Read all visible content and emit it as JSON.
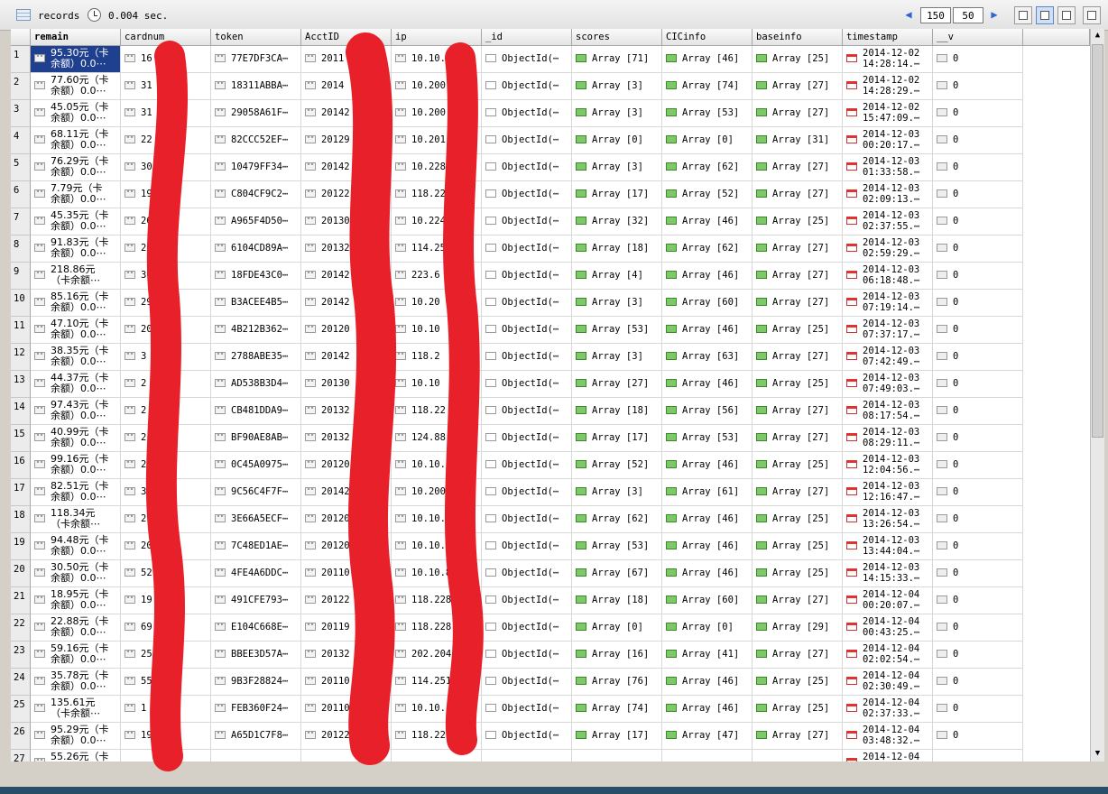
{
  "toolbar": {
    "records_label": "records",
    "time_label": "0.004 sec.",
    "start_value": "150",
    "limit_value": "50",
    "icons": {
      "records": "table-grid-icon",
      "time": "clock-icon",
      "prev": "arrow-left-icon",
      "next": "arrow-right-icon"
    }
  },
  "columns": [
    "remain",
    "cardnum",
    "token",
    "AcctID",
    "ip",
    "_id",
    "scores",
    "CICinfo",
    "baseinfo",
    "timestamp",
    "__v"
  ],
  "rows": [
    {
      "n": "1",
      "remain": "95.30元（卡\n余额）0.0⋯",
      "cardnum": "16",
      "token": "77E7DF3CA⋯",
      "acct": "2011",
      "ip": "10.10.",
      "oid": "ObjectId(⋯",
      "scores": "Array [71]",
      "cic": "Array [46]",
      "base": "Array [25]",
      "ts": "2014-12-02\n14:28:14.⋯",
      "v": "0"
    },
    {
      "n": "2",
      "remain": "77.60元（卡\n余额）0.0⋯",
      "cardnum": "31",
      "token": "18311ABBA⋯",
      "acct": "2014",
      "ip": "10.200",
      "oid": "ObjectId(⋯",
      "scores": "Array [3]",
      "cic": "Array [74]",
      "base": "Array [27]",
      "ts": "2014-12-02\n14:28:29.⋯",
      "v": "0"
    },
    {
      "n": "3",
      "remain": "45.05元（卡\n余额）0.0⋯",
      "cardnum": "31",
      "token": "29058A61F⋯",
      "acct": "20142",
      "ip": "10.200",
      "oid": "ObjectId(⋯",
      "scores": "Array [3]",
      "cic": "Array [53]",
      "base": "Array [27]",
      "ts": "2014-12-02\n15:47:09.⋯",
      "v": "0"
    },
    {
      "n": "4",
      "remain": "68.11元（卡\n余额）0.0⋯",
      "cardnum": "22",
      "token": "82CCC52EF⋯",
      "acct": "20129",
      "ip": "10.201",
      "oid": "ObjectId(⋯",
      "scores": "Array [0]",
      "cic": "Array [0]",
      "base": "Array [31]",
      "ts": "2014-12-03\n00:20:17.⋯",
      "v": "0"
    },
    {
      "n": "5",
      "remain": "76.29元（卡\n余额）0.0⋯",
      "cardnum": "30",
      "token": "10479FF34⋯",
      "acct": "20142",
      "ip": "10.228",
      "oid": "ObjectId(⋯",
      "scores": "Array [3]",
      "cic": "Array [62]",
      "base": "Array [27]",
      "ts": "2014-12-03\n01:33:58.⋯",
      "v": "0"
    },
    {
      "n": "6",
      "remain": "7.79元（卡\n余额）0.0⋯",
      "cardnum": "19",
      "token": "C804CF9C2⋯",
      "acct": "20122",
      "ip": "118.22",
      "oid": "ObjectId(⋯",
      "scores": "Array [17]",
      "cic": "Array [52]",
      "base": "Array [27]",
      "ts": "2014-12-03\n02:09:13.⋯",
      "v": "0"
    },
    {
      "n": "7",
      "remain": "45.35元（卡\n余额）0.0⋯",
      "cardnum": "26",
      "token": "A965F4D50⋯",
      "acct": "20130",
      "ip": "10.224",
      "oid": "ObjectId(⋯",
      "scores": "Array [32]",
      "cic": "Array [46]",
      "base": "Array [25]",
      "ts": "2014-12-03\n02:37:55.⋯",
      "v": "0"
    },
    {
      "n": "8",
      "remain": "91.83元（卡\n余额）0.0⋯",
      "cardnum": "25",
      "token": "6104CD89A⋯",
      "acct": "20132",
      "ip": "114.25",
      "oid": "ObjectId(⋯",
      "scores": "Array [18]",
      "cic": "Array [62]",
      "base": "Array [27]",
      "ts": "2014-12-03\n02:59:29.⋯",
      "v": "0"
    },
    {
      "n": "9",
      "remain": "218.86元\n（卡余额⋯",
      "cardnum": "30",
      "token": "18FDE43C0⋯",
      "acct": "20142",
      "ip": "223.6",
      "oid": "ObjectId(⋯",
      "scores": "Array [4]",
      "cic": "Array [46]",
      "base": "Array [27]",
      "ts": "2014-12-03\n06:18:48.⋯",
      "v": "0"
    },
    {
      "n": "10",
      "remain": "85.16元（卡\n余额）0.0⋯",
      "cardnum": "29",
      "token": "B3ACEE4B5⋯",
      "acct": "20142",
      "ip": "10.20",
      "oid": "ObjectId(⋯",
      "scores": "Array [3]",
      "cic": "Array [60]",
      "base": "Array [27]",
      "ts": "2014-12-03\n07:19:14.⋯",
      "v": "0"
    },
    {
      "n": "11",
      "remain": "47.10元（卡\n余额）0.0⋯",
      "cardnum": "20",
      "token": "4B212B362⋯",
      "acct": "20120",
      "ip": "10.10",
      "oid": "ObjectId(⋯",
      "scores": "Array [53]",
      "cic": "Array [46]",
      "base": "Array [25]",
      "ts": "2014-12-03\n07:37:17.⋯",
      "v": "0"
    },
    {
      "n": "12",
      "remain": "38.35元（卡\n余额）0.0⋯",
      "cardnum": "3",
      "token": "2788ABE35⋯",
      "acct": "20142",
      "ip": "118.2",
      "oid": "ObjectId(⋯",
      "scores": "Array [3]",
      "cic": "Array [63]",
      "base": "Array [27]",
      "ts": "2014-12-03\n07:42:49.⋯",
      "v": "0"
    },
    {
      "n": "13",
      "remain": "44.37元（卡\n余额）0.0⋯",
      "cardnum": "2",
      "token": "AD538B3D4⋯",
      "acct": "20130",
      "ip": "10.10",
      "oid": "ObjectId(⋯",
      "scores": "Array [27]",
      "cic": "Array [46]",
      "base": "Array [25]",
      "ts": "2014-12-03\n07:49:03.⋯",
      "v": "0"
    },
    {
      "n": "14",
      "remain": "97.43元（卡\n余额）0.0⋯",
      "cardnum": "2",
      "token": "CB481DDA9⋯",
      "acct": "20132",
      "ip": "118.22",
      "oid": "ObjectId(⋯",
      "scores": "Array [18]",
      "cic": "Array [56]",
      "base": "Array [27]",
      "ts": "2014-12-03\n08:17:54.⋯",
      "v": "0"
    },
    {
      "n": "15",
      "remain": "40.99元（卡\n余额）0.0⋯",
      "cardnum": "2",
      "token": "BF90AE8AB⋯",
      "acct": "20132",
      "ip": "124.88",
      "oid": "ObjectId(⋯",
      "scores": "Array [17]",
      "cic": "Array [53]",
      "base": "Array [27]",
      "ts": "2014-12-03\n08:29:11.⋯",
      "v": "0"
    },
    {
      "n": "16",
      "remain": "99.16元（卡\n余额）0.0⋯",
      "cardnum": "2",
      "token": "0C45A0975⋯",
      "acct": "20120",
      "ip": "10.10.",
      "oid": "ObjectId(⋯",
      "scores": "Array [52]",
      "cic": "Array [46]",
      "base": "Array [25]",
      "ts": "2014-12-03\n12:04:56.⋯",
      "v": "0"
    },
    {
      "n": "17",
      "remain": "82.51元（卡\n余额）0.0⋯",
      "cardnum": "3",
      "token": "9C56C4F7F⋯",
      "acct": "20142",
      "ip": "10.200",
      "oid": "ObjectId(⋯",
      "scores": "Array [3]",
      "cic": "Array [61]",
      "base": "Array [27]",
      "ts": "2014-12-03\n12:16:47.⋯",
      "v": "0"
    },
    {
      "n": "18",
      "remain": "118.34元\n（卡余额⋯",
      "cardnum": "2",
      "token": "3E66A5ECF⋯",
      "acct": "20120",
      "ip": "10.10.",
      "oid": "ObjectId(⋯",
      "scores": "Array [62]",
      "cic": "Array [46]",
      "base": "Array [25]",
      "ts": "2014-12-03\n13:26:54.⋯",
      "v": "0"
    },
    {
      "n": "19",
      "remain": "94.48元（卡\n余额）0.0⋯",
      "cardnum": "20",
      "token": "7C48ED1AE⋯",
      "acct": "20120",
      "ip": "10.10.",
      "oid": "ObjectId(⋯",
      "scores": "Array [53]",
      "cic": "Array [46]",
      "base": "Array [25]",
      "ts": "2014-12-03\n13:44:04.⋯",
      "v": "0"
    },
    {
      "n": "20",
      "remain": "30.50元（卡\n余额）0.0⋯",
      "cardnum": "52",
      "token": "4FE4A6DDC⋯",
      "acct": "20110",
      "ip": "10.10.8",
      "oid": "ObjectId(⋯",
      "scores": "Array [67]",
      "cic": "Array [46]",
      "base": "Array [25]",
      "ts": "2014-12-03\n14:15:33.⋯",
      "v": "0"
    },
    {
      "n": "21",
      "remain": "18.95元（卡\n余额）0.0⋯",
      "cardnum": "19",
      "token": "491CFE793⋯",
      "acct": "20122",
      "ip": "118.228",
      "oid": "ObjectId(⋯",
      "scores": "Array [18]",
      "cic": "Array [60]",
      "base": "Array [27]",
      "ts": "2014-12-04\n00:20:07.⋯",
      "v": "0"
    },
    {
      "n": "22",
      "remain": "22.88元（卡\n余额）0.0⋯",
      "cardnum": "69",
      "token": "E104C668E⋯",
      "acct": "20119",
      "ip": "118.228.",
      "oid": "ObjectId(⋯",
      "scores": "Array [0]",
      "cic": "Array [0]",
      "base": "Array [29]",
      "ts": "2014-12-04\n00:43:25.⋯",
      "v": "0"
    },
    {
      "n": "23",
      "remain": "59.16元（卡\n余额）0.0⋯",
      "cardnum": "25",
      "token": "BBEE3D57A⋯",
      "acct": "20132",
      "ip": "202.204",
      "oid": "ObjectId(⋯",
      "scores": "Array [16]",
      "cic": "Array [41]",
      "base": "Array [27]",
      "ts": "2014-12-04\n02:02:54.⋯",
      "v": "0"
    },
    {
      "n": "24",
      "remain": "35.78元（卡\n余额）0.0⋯",
      "cardnum": "55",
      "token": "9B3F28824⋯",
      "acct": "20110",
      "ip": "114.251",
      "oid": "ObjectId(⋯",
      "scores": "Array [76]",
      "cic": "Array [46]",
      "base": "Array [25]",
      "ts": "2014-12-04\n02:30:49.⋯",
      "v": "0"
    },
    {
      "n": "25",
      "remain": "135.61元\n（卡余额⋯",
      "cardnum": "1",
      "token": "FEB360F24⋯",
      "acct": "20110",
      "ip": "10.10.",
      "oid": "ObjectId(⋯",
      "scores": "Array [74]",
      "cic": "Array [46]",
      "base": "Array [25]",
      "ts": "2014-12-04\n02:37:33.⋯",
      "v": "0"
    },
    {
      "n": "26",
      "remain": "95.29元（卡\n余额）0.0⋯",
      "cardnum": "19",
      "token": "A65D1C7F8⋯",
      "acct": "20122",
      "ip": "118.22",
      "oid": "ObjectId(⋯",
      "scores": "Array [17]",
      "cic": "Array [47]",
      "base": "Array [27]",
      "ts": "2014-12-04\n03:48:32.⋯",
      "v": "0"
    },
    {
      "n": "27",
      "remain": "55.26元（卡\n",
      "cardnum": "",
      "token": "",
      "acct": "",
      "ip": "",
      "oid": "",
      "scores": "",
      "cic": "",
      "base": "",
      "ts": "2014-12-04\n",
      "v": ""
    }
  ],
  "colors": {
    "selection": "#1f3f8f",
    "redaction": "#e8202a",
    "array_icon": "#7ec86a",
    "status_strip": "#274d69"
  }
}
